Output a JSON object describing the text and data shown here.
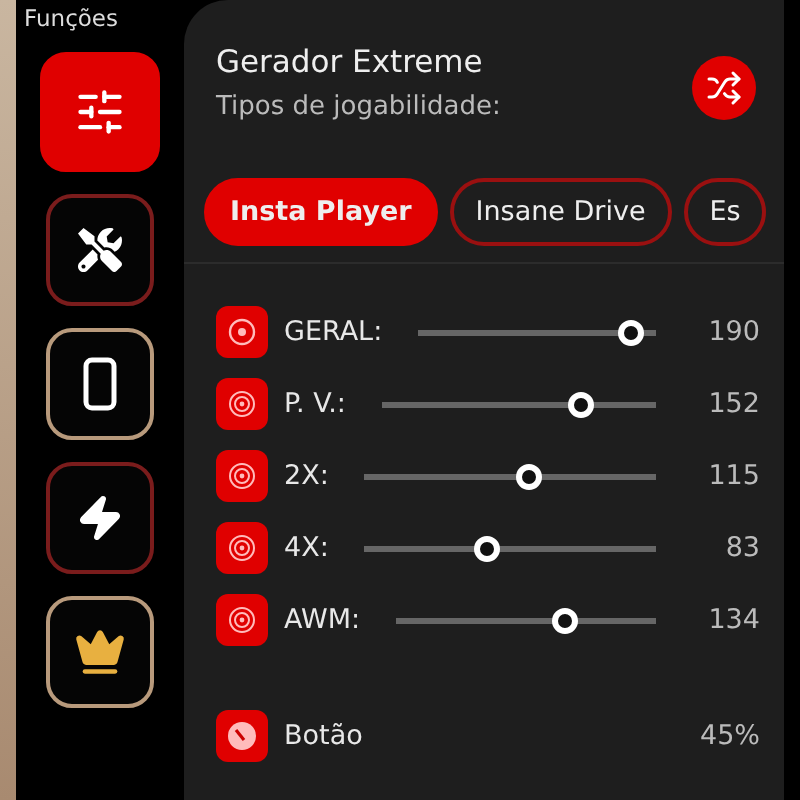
{
  "sidebar": {
    "title": "Funções",
    "items": [
      {
        "selected": true,
        "color": "#e00000"
      },
      {
        "selected": false,
        "color": "#7a1c1c"
      },
      {
        "selected": false,
        "color": "#b89a7c"
      },
      {
        "selected": false,
        "color": "#7a1c1c"
      },
      {
        "selected": false,
        "color": "#b89a7c"
      }
    ]
  },
  "panel": {
    "title": "Gerador Extreme",
    "subtitle": "Tipos de jogabilidade:",
    "tabs": [
      {
        "label": "Insta Player",
        "selected": true
      },
      {
        "label": "Insane Drive",
        "selected": false
      },
      {
        "label": "Es",
        "selected": false
      }
    ],
    "sliders": [
      {
        "label": "GERAL:",
        "level": 0.94,
        "reading": "190"
      },
      {
        "label": "P. V.:",
        "level": 0.75,
        "reading": "152"
      },
      {
        "label": "2X:",
        "level": 0.57,
        "reading": "115"
      },
      {
        "label": "4X:",
        "level": 0.41,
        "reading": "83"
      },
      {
        "label": "AWM:",
        "level": 0.66,
        "reading": "134"
      }
    ],
    "button_row": {
      "label": "Botão",
      "reading": "45%"
    }
  }
}
